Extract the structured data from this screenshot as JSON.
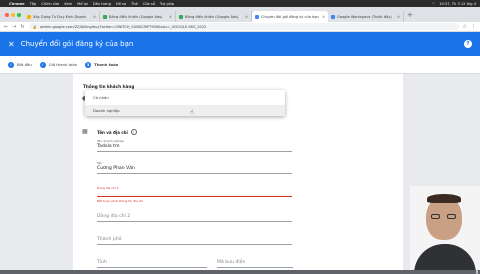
{
  "menubar": {
    "app": "Chrome",
    "items": [
      "Tệp",
      "Chỉnh sửa",
      "Xem",
      "Mở lại",
      "Dấu trang",
      "Hồ sơ",
      "Thẻ",
      "Cửa sổ",
      "Trợ giúp"
    ],
    "clock": "10:37, Th 3 12 thg 4"
  },
  "tabs": [
    {
      "label": "Xây Dựng Tư Duy Kinh Doanh"
    },
    {
      "label": "Bảng điều khiển (Google Ads)"
    },
    {
      "label": "Bảng điều khiển (Google Ads)"
    },
    {
      "label": "Chuyển đổi gói đăng ký của bạn"
    },
    {
      "label": "Google Workspace (Trước đây)"
    }
  ],
  "address": {
    "url": "admin.google.com/ZZ/billing/buy?action=SWITCH_SUBSCRIPTION&sku=_GOOGLE-SKS_2022"
  },
  "appbar": {
    "title": "Chuyển đổi gói đăng ký của bạn",
    "help": "?"
  },
  "steps": [
    {
      "label": "Bắt đầu",
      "state": "done"
    },
    {
      "label": "Giỏ thanh toán",
      "state": "done"
    },
    {
      "label": "Thanh toán",
      "state": "current",
      "num": "3"
    }
  ],
  "form": {
    "section_title": "Thông tin khách hàng",
    "dropdown": {
      "options": [
        "Cá nhân",
        "Doanh nghiệp"
      ],
      "highlighted": "Doanh nghiệp"
    },
    "address_section": "Tên và địa chỉ",
    "info_glyph": "i",
    "fields": {
      "business_name": {
        "label": "Tên doanh nghiệp",
        "value": "Tadola tm"
      },
      "contact_name": {
        "label": "Tên",
        "value": "Cương Phan Văn"
      },
      "address1": {
        "label": "Dòng địa chỉ 1",
        "error": "Bắt buộc phải thông tin địa chỉ"
      },
      "address2": {
        "placeholder": "Dòng địa chỉ 2"
      },
      "city": {
        "placeholder": "Thành phố"
      },
      "province": {
        "placeholder": "Tỉnh"
      },
      "zip": {
        "placeholder": "Mã bưu điện"
      }
    }
  }
}
